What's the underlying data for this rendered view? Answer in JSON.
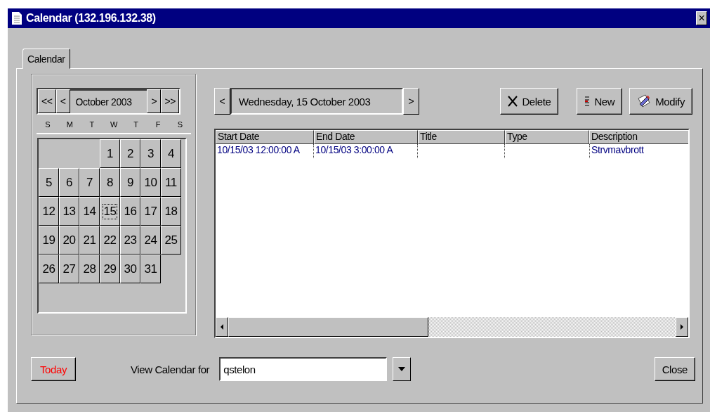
{
  "window": {
    "title": "Calendar (132.196.132.38)",
    "close": "×"
  },
  "tabs": [
    {
      "label": "Calendar",
      "selected": true
    }
  ],
  "month_nav": {
    "first": "<<",
    "prev": "<",
    "month": "October 2003",
    "next": ">",
    "last": ">>"
  },
  "weekdays": [
    "S",
    "M",
    "T",
    "W",
    "T",
    "F",
    "S"
  ],
  "weeks": [
    {
      "kind": "end",
      "days": [
        {
          "label": "1",
          "selected": false
        },
        {
          "label": "2",
          "selected": false
        },
        {
          "label": "3",
          "selected": false
        },
        {
          "label": "4",
          "selected": false
        }
      ]
    },
    {
      "kind": "full",
      "days": [
        {
          "label": "5",
          "selected": false
        },
        {
          "label": "6",
          "selected": false
        },
        {
          "label": "7",
          "selected": false
        },
        {
          "label": "8",
          "selected": false
        },
        {
          "label": "9",
          "selected": false
        },
        {
          "label": "10",
          "selected": false
        },
        {
          "label": "11",
          "selected": false
        }
      ]
    },
    {
      "kind": "full",
      "days": [
        {
          "label": "12",
          "selected": false
        },
        {
          "label": "13",
          "selected": false
        },
        {
          "label": "14",
          "selected": false
        },
        {
          "label": "15",
          "selected": true
        },
        {
          "label": "16",
          "selected": false
        },
        {
          "label": "17",
          "selected": false
        },
        {
          "label": "18",
          "selected": false
        }
      ]
    },
    {
      "kind": "full",
      "days": [
        {
          "label": "19",
          "selected": false
        },
        {
          "label": "20",
          "selected": false
        },
        {
          "label": "21",
          "selected": false
        },
        {
          "label": "22",
          "selected": false
        },
        {
          "label": "23",
          "selected": false
        },
        {
          "label": "24",
          "selected": false
        },
        {
          "label": "25",
          "selected": false
        }
      ]
    },
    {
      "kind": "start",
      "days": [
        {
          "label": "26",
          "selected": false
        },
        {
          "label": "27",
          "selected": false
        },
        {
          "label": "28",
          "selected": false
        },
        {
          "label": "29",
          "selected": false
        },
        {
          "label": "30",
          "selected": false
        },
        {
          "label": "31",
          "selected": false
        }
      ]
    }
  ],
  "day_nav": {
    "prev": "<",
    "date": "Wednesday, 15 October 2003",
    "next": ">"
  },
  "toolbar": [
    {
      "kind": "delete",
      "label": "Delete"
    },
    {
      "kind": "new",
      "label": "New"
    },
    {
      "kind": "modify",
      "label": "Modify"
    }
  ],
  "table": {
    "columns": [
      "Start Date",
      "End Date",
      "Title",
      "Type",
      "Description"
    ],
    "rows": [
      [
        "10/15/03 12:00:00 A",
        "10/15/03 3:00:00 A",
        "",
        "",
        "Strvmavbrott"
      ]
    ]
  },
  "today_button": "Today",
  "view_for": {
    "label": "View Calendar for",
    "value": "qstelon"
  },
  "close_button": "Close"
}
